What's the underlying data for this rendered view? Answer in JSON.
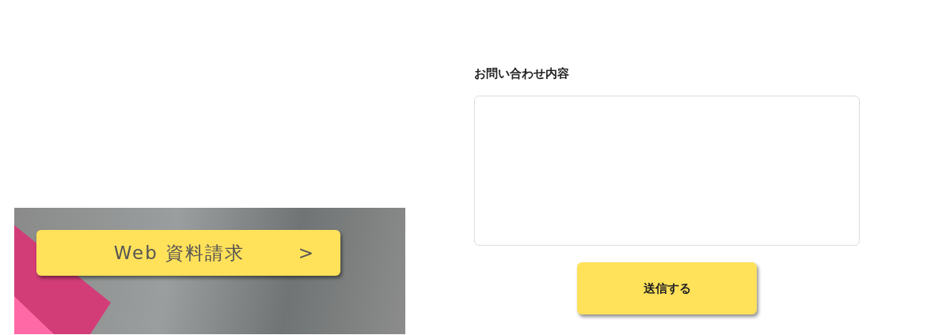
{
  "banner": {
    "button": {
      "label": "Web 資料請求",
      "arrow": ">"
    }
  },
  "form": {
    "label": "お問い合わせ内容",
    "submit_button": "送信する"
  }
}
